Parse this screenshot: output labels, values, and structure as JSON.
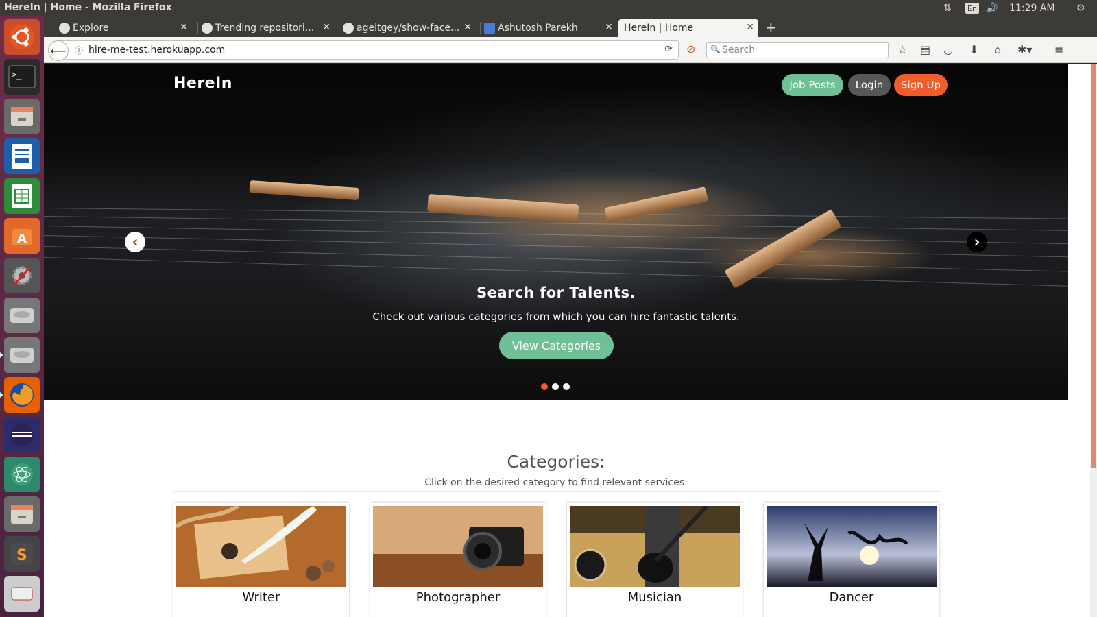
{
  "os": {
    "window_title": "HereIn | Home - Mozilla Firefox",
    "keyboard_lang": "En",
    "clock": "11:29 AM"
  },
  "browser": {
    "tabs": [
      {
        "label": "Explore"
      },
      {
        "label": "Trending repositori..."
      },
      {
        "label": "ageitgey/show-face..."
      },
      {
        "label": "Ashutosh Parekh"
      },
      {
        "label": "HereIn | Home"
      }
    ],
    "url": "hire-me-test.herokuapp.com",
    "search_placeholder": "Search"
  },
  "site": {
    "brand": "HereIn",
    "nav": {
      "job_posts": "Job Posts",
      "login": "Login",
      "sign_up": "Sign Up"
    },
    "hero": {
      "title": "Search for Talents.",
      "subtitle": "Check out various categories from which you can hire fantastic talents.",
      "cta": "View Categories",
      "active_slide": 1,
      "slide_count": 3
    },
    "categories": {
      "title": "Categories:",
      "subtitle": "Click on the desired category to find relevant services:",
      "items": [
        {
          "label": "Writer"
        },
        {
          "label": "Photographer"
        },
        {
          "label": "Musician"
        },
        {
          "label": "Dancer"
        }
      ]
    }
  },
  "colors": {
    "accent_green": "#6fbf97",
    "accent_orange": "#ee5d2b",
    "login_gray": "#555759"
  }
}
